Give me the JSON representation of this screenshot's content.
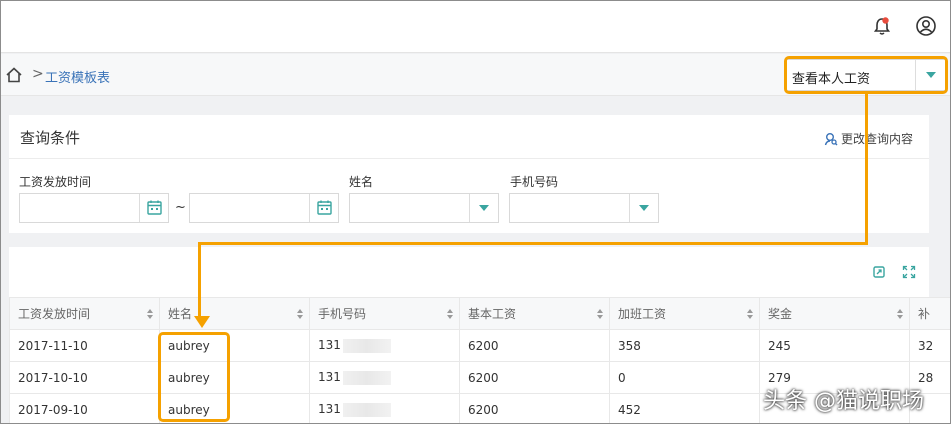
{
  "header": {
    "notification_icon": "bell-icon",
    "user_icon": "user-circle-icon",
    "notification_dot_color": "#e84c3d"
  },
  "breadcrumb": {
    "home_icon": "home-icon",
    "separator": ">",
    "current": "工资模板表"
  },
  "view_select": {
    "value": "查看本人工资"
  },
  "query": {
    "title": "查询条件",
    "edit_link": "更改查询内容",
    "fields": {
      "pay_date_label": "工资发放时间",
      "range_separator": "~",
      "name_label": "姓名",
      "phone_label": "手机号码"
    }
  },
  "table": {
    "columns": [
      "工资发放时间",
      "姓名",
      "手机号码",
      "基本工资",
      "加班工资",
      "奖金",
      "补"
    ],
    "rows": [
      [
        "2017-11-10",
        "aubrey",
        "131",
        "6200",
        "358",
        "245",
        "32"
      ],
      [
        "2017-10-10",
        "aubrey",
        "131",
        "6200",
        "0",
        "279",
        "28"
      ],
      [
        "2017-09-10",
        "aubrey",
        "131",
        "6200",
        "452",
        "",
        ""
      ]
    ]
  },
  "annotation_color": "#f5a100",
  "watermark": "头条 @猫说职场"
}
